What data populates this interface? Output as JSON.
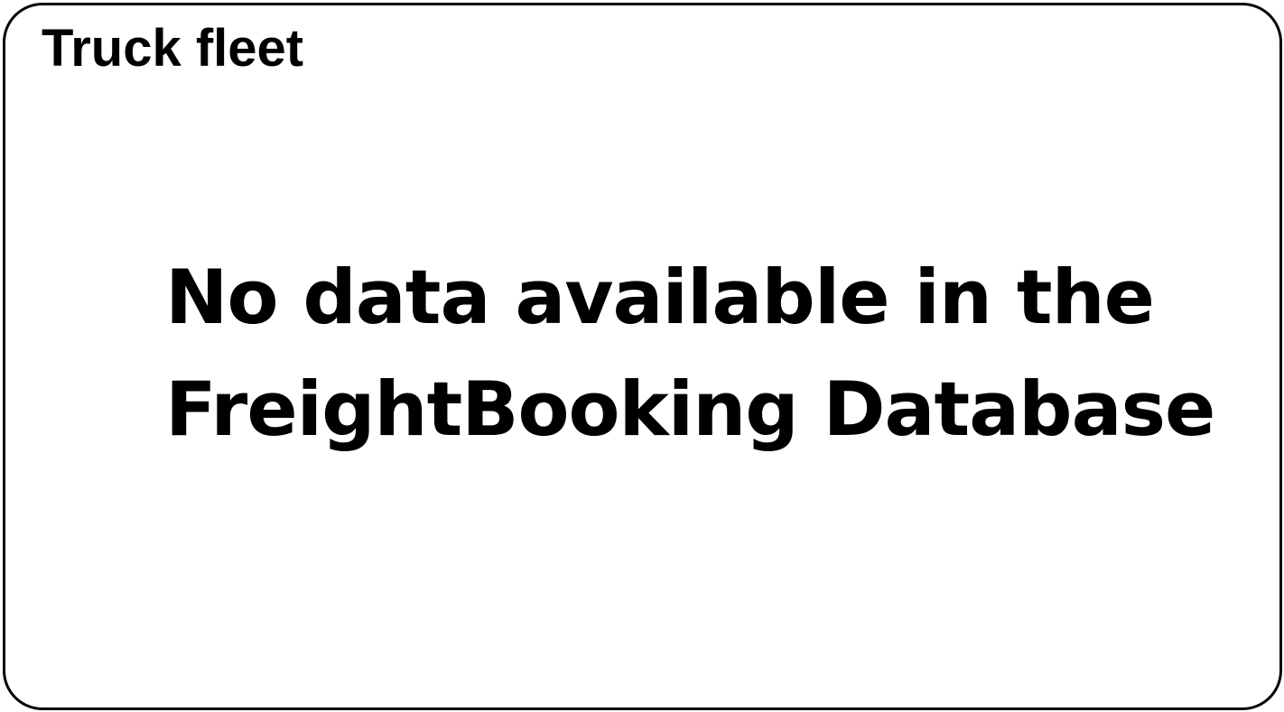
{
  "panel": {
    "title": "Truck fleet",
    "empty_state": {
      "line1": "No data available in the",
      "line2": "FreightBooking Database"
    }
  },
  "colors": {
    "border": "#000000",
    "text": "#000000",
    "background": "#ffffff"
  }
}
